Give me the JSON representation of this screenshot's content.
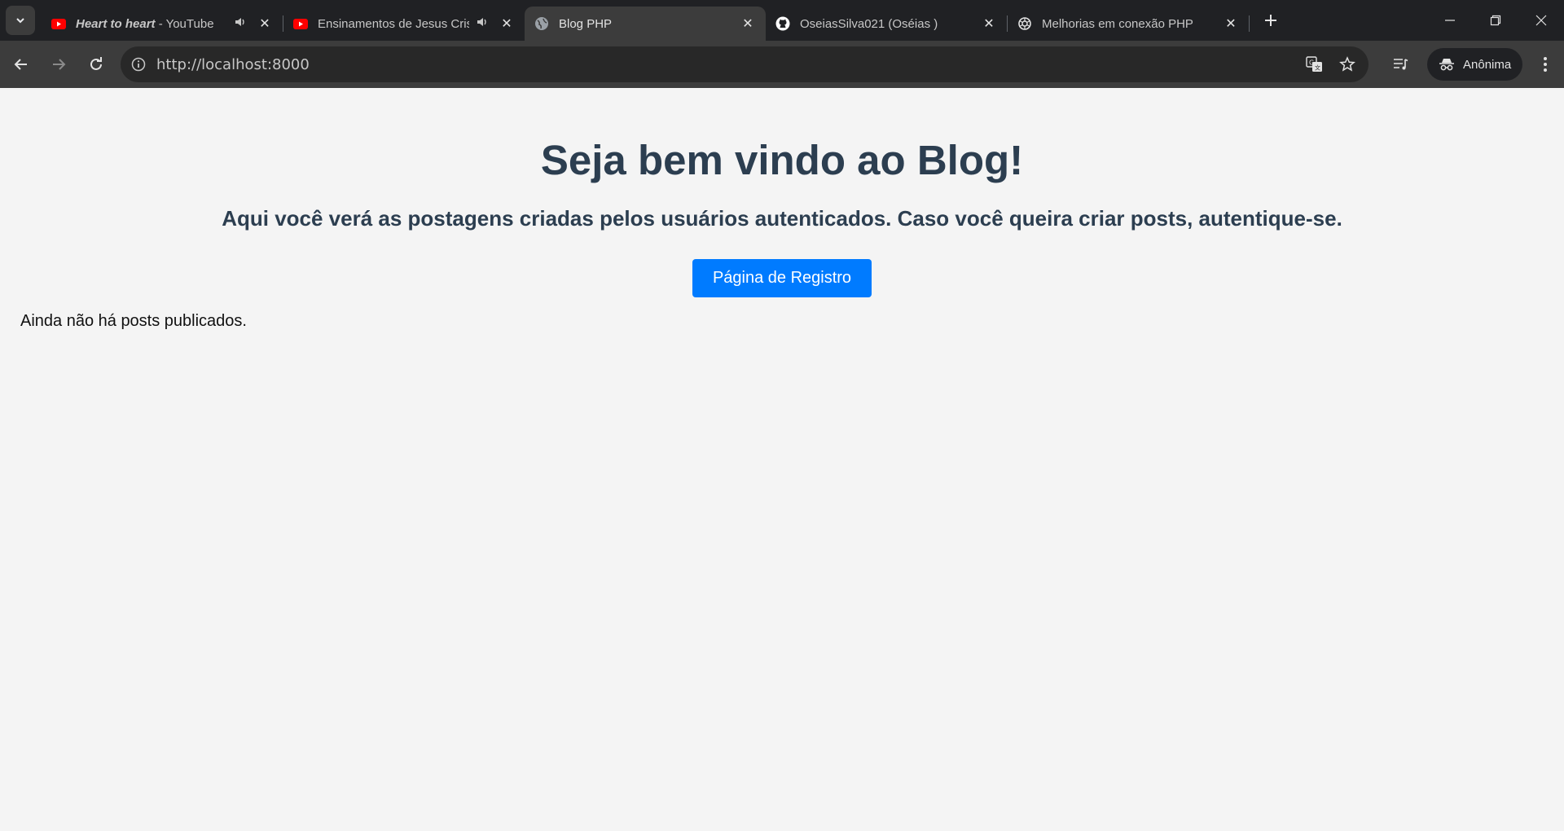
{
  "browser": {
    "tabs": [
      {
        "title_bold": "Heart to heart",
        "title_rest": " - YouTube",
        "favicon": "youtube-icon",
        "audio": true,
        "active": false
      },
      {
        "title_bold": "",
        "title_rest": "Ensinamentos de Jesus Cristo",
        "favicon": "youtube-icon",
        "audio": true,
        "active": false
      },
      {
        "title_bold": "",
        "title_rest": "Blog PHP",
        "favicon": "globe-icon",
        "audio": false,
        "active": true
      },
      {
        "title_bold": "",
        "title_rest": "OseiasSilva021 (Oséias )",
        "favicon": "github-icon",
        "audio": false,
        "active": false
      },
      {
        "title_bold": "",
        "title_rest": "Melhorias em conexão PHP",
        "favicon": "openai-icon",
        "audio": false,
        "active": false
      }
    ],
    "url": "http://localhost:8000",
    "profile_label": "Anônima",
    "colors": {
      "youtube": "#ff0000",
      "button": "#007bff",
      "heading": "#2c3e50"
    }
  },
  "page": {
    "heading": "Seja bem vindo ao Blog!",
    "subheading": "Aqui você verá as postagens criadas pelos usuários autenticados. Caso você queira criar posts, autentique-se.",
    "register_button": "Página de Registro",
    "empty_message": "Ainda não há posts publicados."
  }
}
